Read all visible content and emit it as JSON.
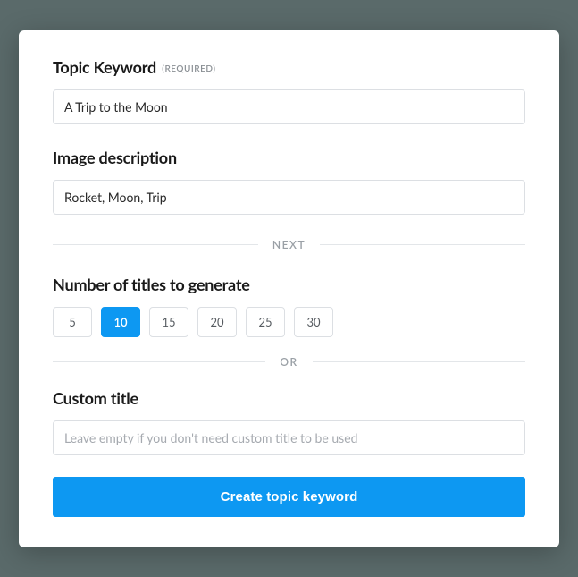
{
  "topic": {
    "label": "Topic Keyword",
    "required": "(REQUIRED)",
    "value": "A Trip to the Moon"
  },
  "image_desc": {
    "label": "Image description",
    "value": "Rocket, Moon, Trip"
  },
  "dividers": {
    "next": "NEXT",
    "or": "OR"
  },
  "titles": {
    "label": "Number of titles to generate",
    "options": [
      "5",
      "10",
      "15",
      "20",
      "25",
      "30"
    ],
    "selected": "10"
  },
  "custom": {
    "label": "Custom title",
    "placeholder": "Leave empty if you don't need custom title to be used",
    "value": ""
  },
  "submit": {
    "label": "Create topic keyword"
  },
  "colors": {
    "accent": "#0d98f2"
  }
}
